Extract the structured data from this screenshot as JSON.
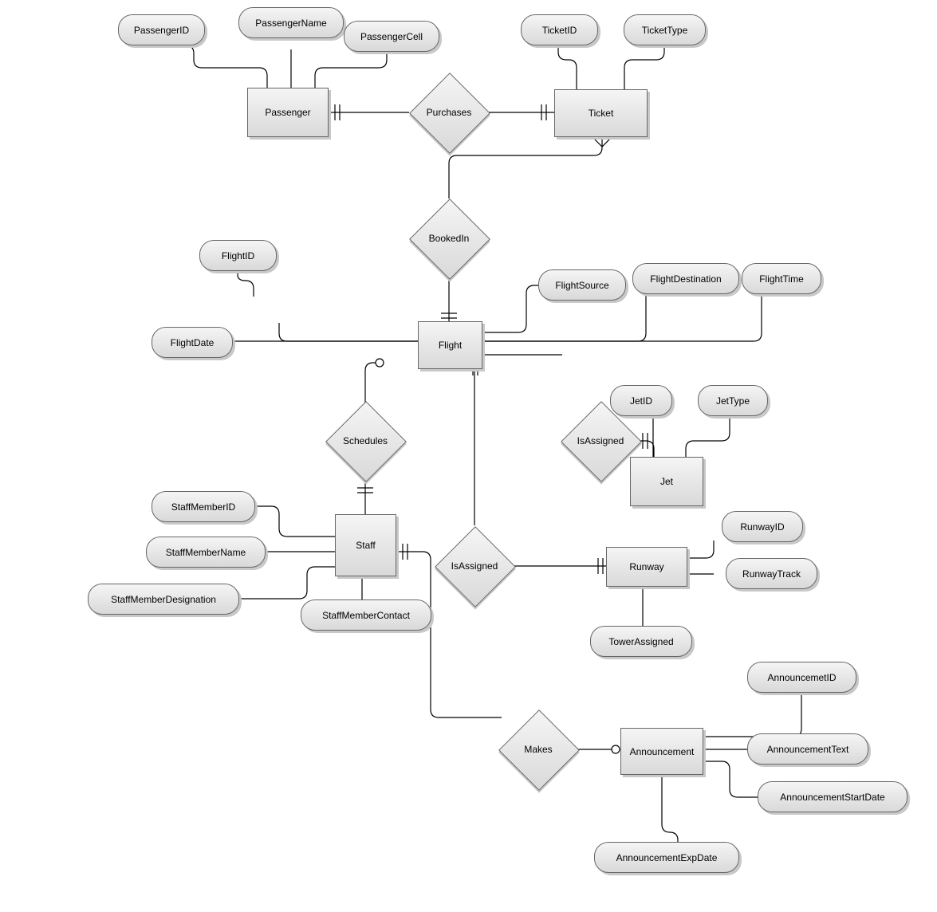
{
  "entities": {
    "passenger": "Passenger",
    "ticket": "Ticket",
    "flight": "Flight",
    "staff": "Staff",
    "jet": "Jet",
    "runway": "Runway",
    "announcement": "Announcement"
  },
  "relationships": {
    "purchases": "Purchases",
    "bookedin": "BookedIn",
    "schedules": "Schedules",
    "isassigned_jet": "IsAssigned",
    "isassigned_runway": "IsAssigned",
    "makes": "Makes"
  },
  "attributes": {
    "passenger_id": "PassengerID",
    "passenger_name": "PassengerName",
    "passenger_cell": "PassengerCell",
    "ticket_id": "TicketID",
    "ticket_type": "TicketType",
    "flight_id": "FlightID",
    "flight_date": "FlightDate",
    "flight_source": "FlightSource",
    "flight_destination": "FlightDestination",
    "flight_time": "FlightTime",
    "staff_member_id": "StaffMemberID",
    "staff_member_name": "StaffMemberName",
    "staff_member_designation": "StaffMemberDesignation",
    "staff_member_contact": "StaffMemberContact",
    "jet_id": "JetID",
    "jet_type": "JetType",
    "runway_id": "RunwayID",
    "runway_track": "RunwayTrack",
    "tower_assigned": "TowerAssigned",
    "announcement_id": "AnnouncemetID",
    "announcement_text": "AnnouncementText",
    "announcement_start_date": "AnnouncementStartDate",
    "announcement_exp_date": "AnnouncementExpDate"
  }
}
